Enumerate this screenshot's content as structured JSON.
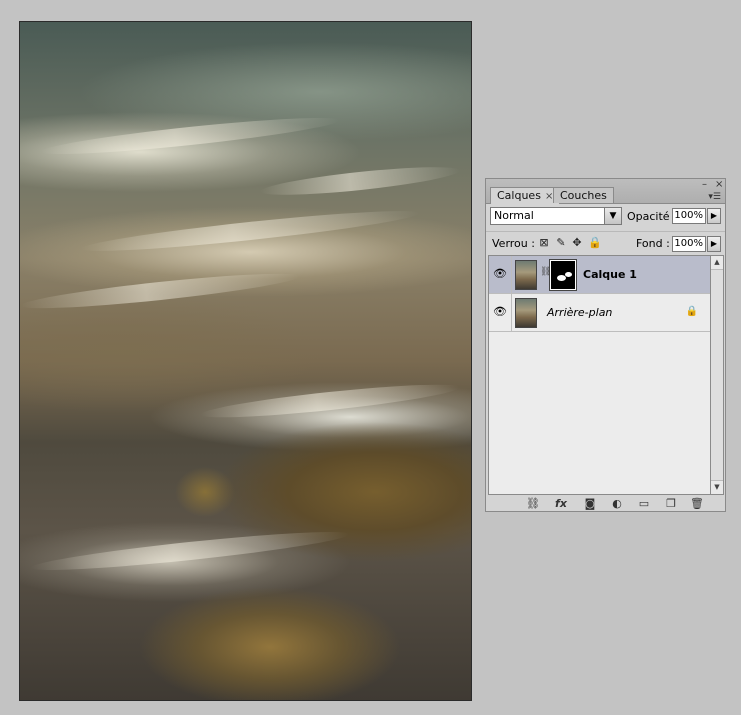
{
  "canvas": {
    "description_icon": "photo-long-exposure-water-rocks"
  },
  "panel": {
    "tabs": [
      {
        "label": "Calques",
        "close": "×",
        "active": true
      },
      {
        "label": "Couches",
        "active": false
      }
    ],
    "window_controls": {
      "minimize": "–",
      "close": "×"
    },
    "menu_icon": "▾☰",
    "blend_mode": "Normal",
    "opacity_label": "Opacité :",
    "opacity_value": "100%",
    "lock_label": "Verrou :",
    "fill_label": "Fond :",
    "fill_value": "100%",
    "lock_icons": [
      "lock-transparency-icon",
      "lock-paint-icon",
      "lock-move-icon",
      "lock-all-icon"
    ],
    "layers": [
      {
        "name": "Calque 1",
        "selected": true,
        "visible": true,
        "has_mask": true
      },
      {
        "name": "Arrière-plan",
        "selected": false,
        "visible": true,
        "locked": true
      }
    ],
    "bottom_icons": [
      "link-layers-icon",
      "layer-style-fx-icon",
      "add-mask-icon",
      "adjustment-layer-icon",
      "new-group-icon",
      "new-layer-icon",
      "delete-layer-icon"
    ],
    "fx_label": "fx"
  }
}
